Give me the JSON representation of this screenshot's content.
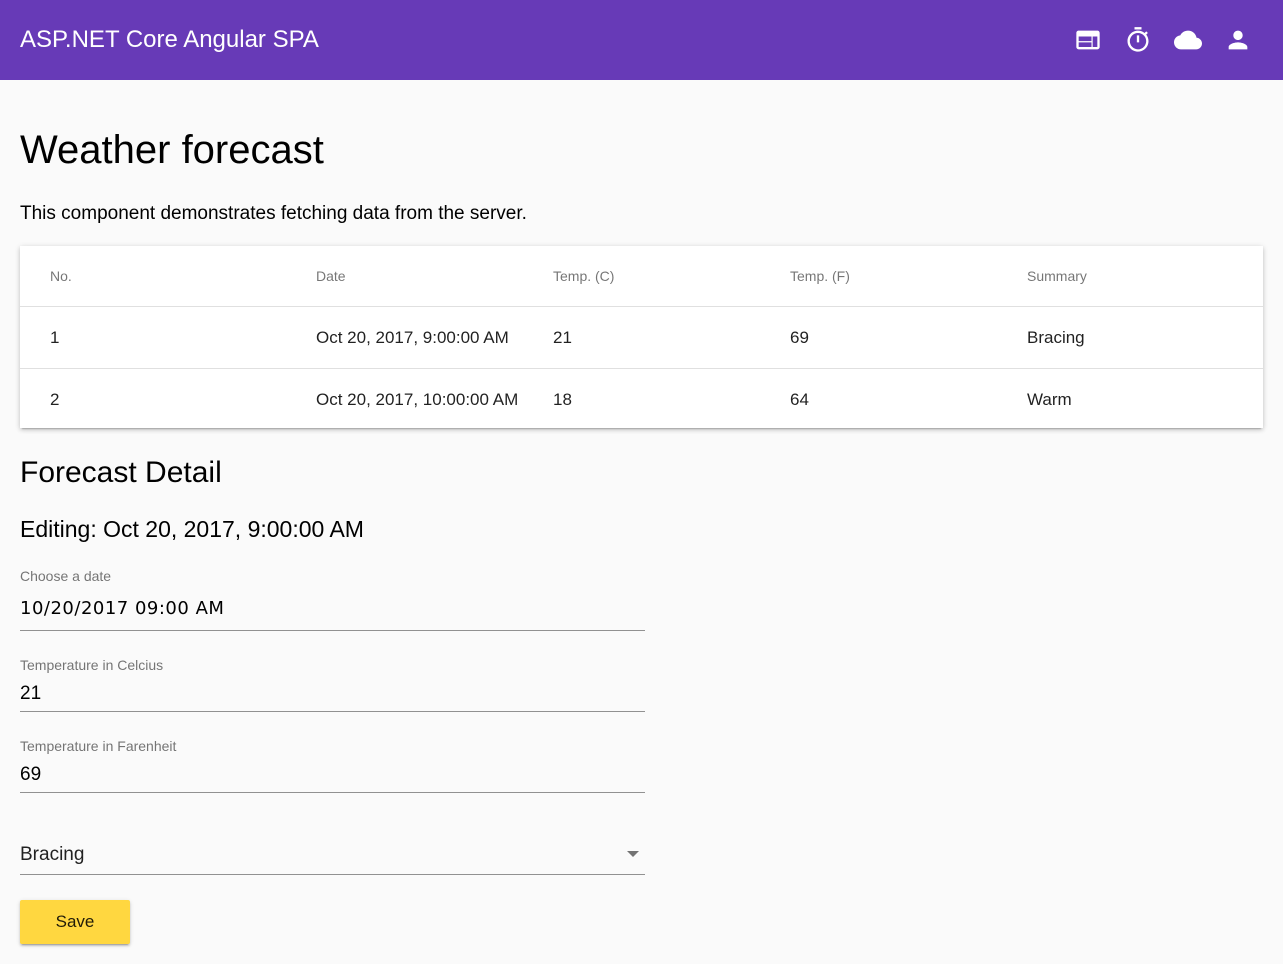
{
  "toolbar": {
    "title": "ASP.NET Core Angular SPA",
    "background": "#673ab7",
    "icons": [
      "web-icon",
      "timer-icon",
      "cloud-icon",
      "person-icon"
    ]
  },
  "page": {
    "title": "Weather forecast",
    "intro": "This component demonstrates fetching data from the server."
  },
  "table": {
    "headers": [
      "No.",
      "Date",
      "Temp. (C)",
      "Temp. (F)",
      "Summary"
    ],
    "rows": [
      [
        "1",
        "Oct 20, 2017, 9:00:00 AM",
        "21",
        "69",
        "Bracing"
      ],
      [
        "2",
        "Oct 20, 2017, 10:00:00 AM",
        "18",
        "64",
        "Warm"
      ]
    ]
  },
  "detail": {
    "title": "Forecast Detail",
    "editing": "Editing: Oct 20, 2017, 9:00:00 AM",
    "date_label": "Choose a date",
    "date_value": "10/20/2017 09:00 AM",
    "celcius_label": "Temperature in Celcius",
    "celcius_value": "21",
    "farenheit_label": "Temperature in Farenheit",
    "farenheit_value": "69",
    "summary_value": "Bracing",
    "save_label": "Save",
    "save_color": "#ffd740"
  }
}
